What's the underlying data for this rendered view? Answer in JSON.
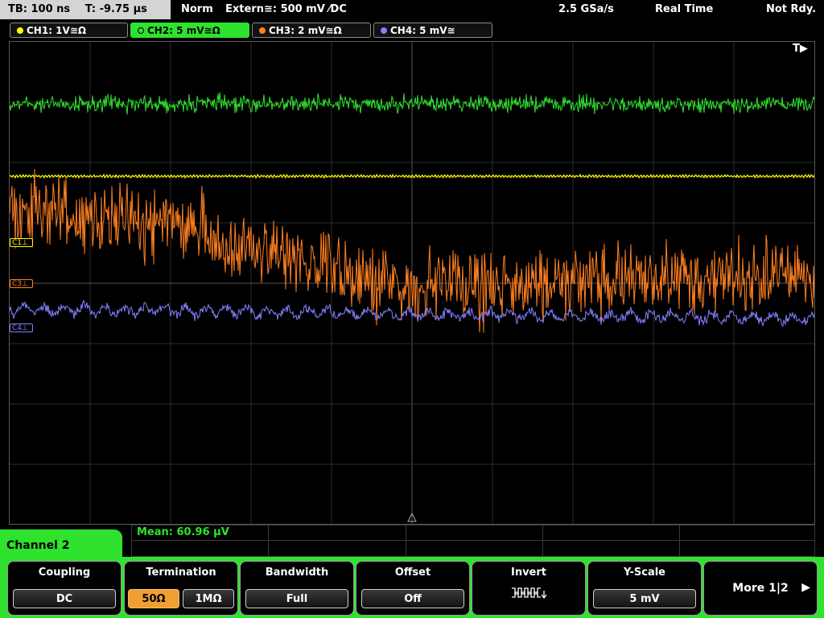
{
  "status": {
    "timebase": "TB: 100 ns",
    "trigger_time": "T: -9.75 µs",
    "mode": "Norm",
    "trigger_source": "Extern≅: 500 mV ⁄DC",
    "sample_rate": "2.5 GSa/s",
    "acq_mode": "Real Time",
    "ready_state": "Not Rdy."
  },
  "channels": [
    {
      "label": "CH1: 1V≅Ω",
      "color": "#ffff00"
    },
    {
      "label": "CH2: 5 mV≅Ω",
      "color": "#2ee22e"
    },
    {
      "label": "CH3: 2 mV≅Ω",
      "color": "#ff8020"
    },
    {
      "label": "CH4: 5 mV≅",
      "color": "#8080ff"
    }
  ],
  "plot": {
    "trigger_marker": "T▶",
    "level_markers": [
      {
        "label": "C1⊥",
        "color": "#ffff00"
      },
      {
        "label": "C3⊥",
        "color": "#ff8020"
      },
      {
        "label": "C4⊥",
        "color": "#8080ff"
      }
    ]
  },
  "panel": {
    "title": "Channel 2",
    "measurement": "Mean: 60.96 µV"
  },
  "softkeys": {
    "coupling": {
      "title": "Coupling",
      "value": "DC"
    },
    "termination": {
      "title": "Termination",
      "opt1": "50Ω",
      "opt2": "1MΩ"
    },
    "bandwidth": {
      "title": "Bandwidth",
      "value": "Full"
    },
    "offset": {
      "title": "Offset",
      "value": "Off"
    },
    "invert": {
      "title": "Invert",
      "icon": "invert-waveform-icon"
    },
    "yscale": {
      "title": "Y-Scale",
      "value": "5 mV"
    },
    "more": {
      "label": "More 1|2",
      "arrow": "▶"
    }
  }
}
